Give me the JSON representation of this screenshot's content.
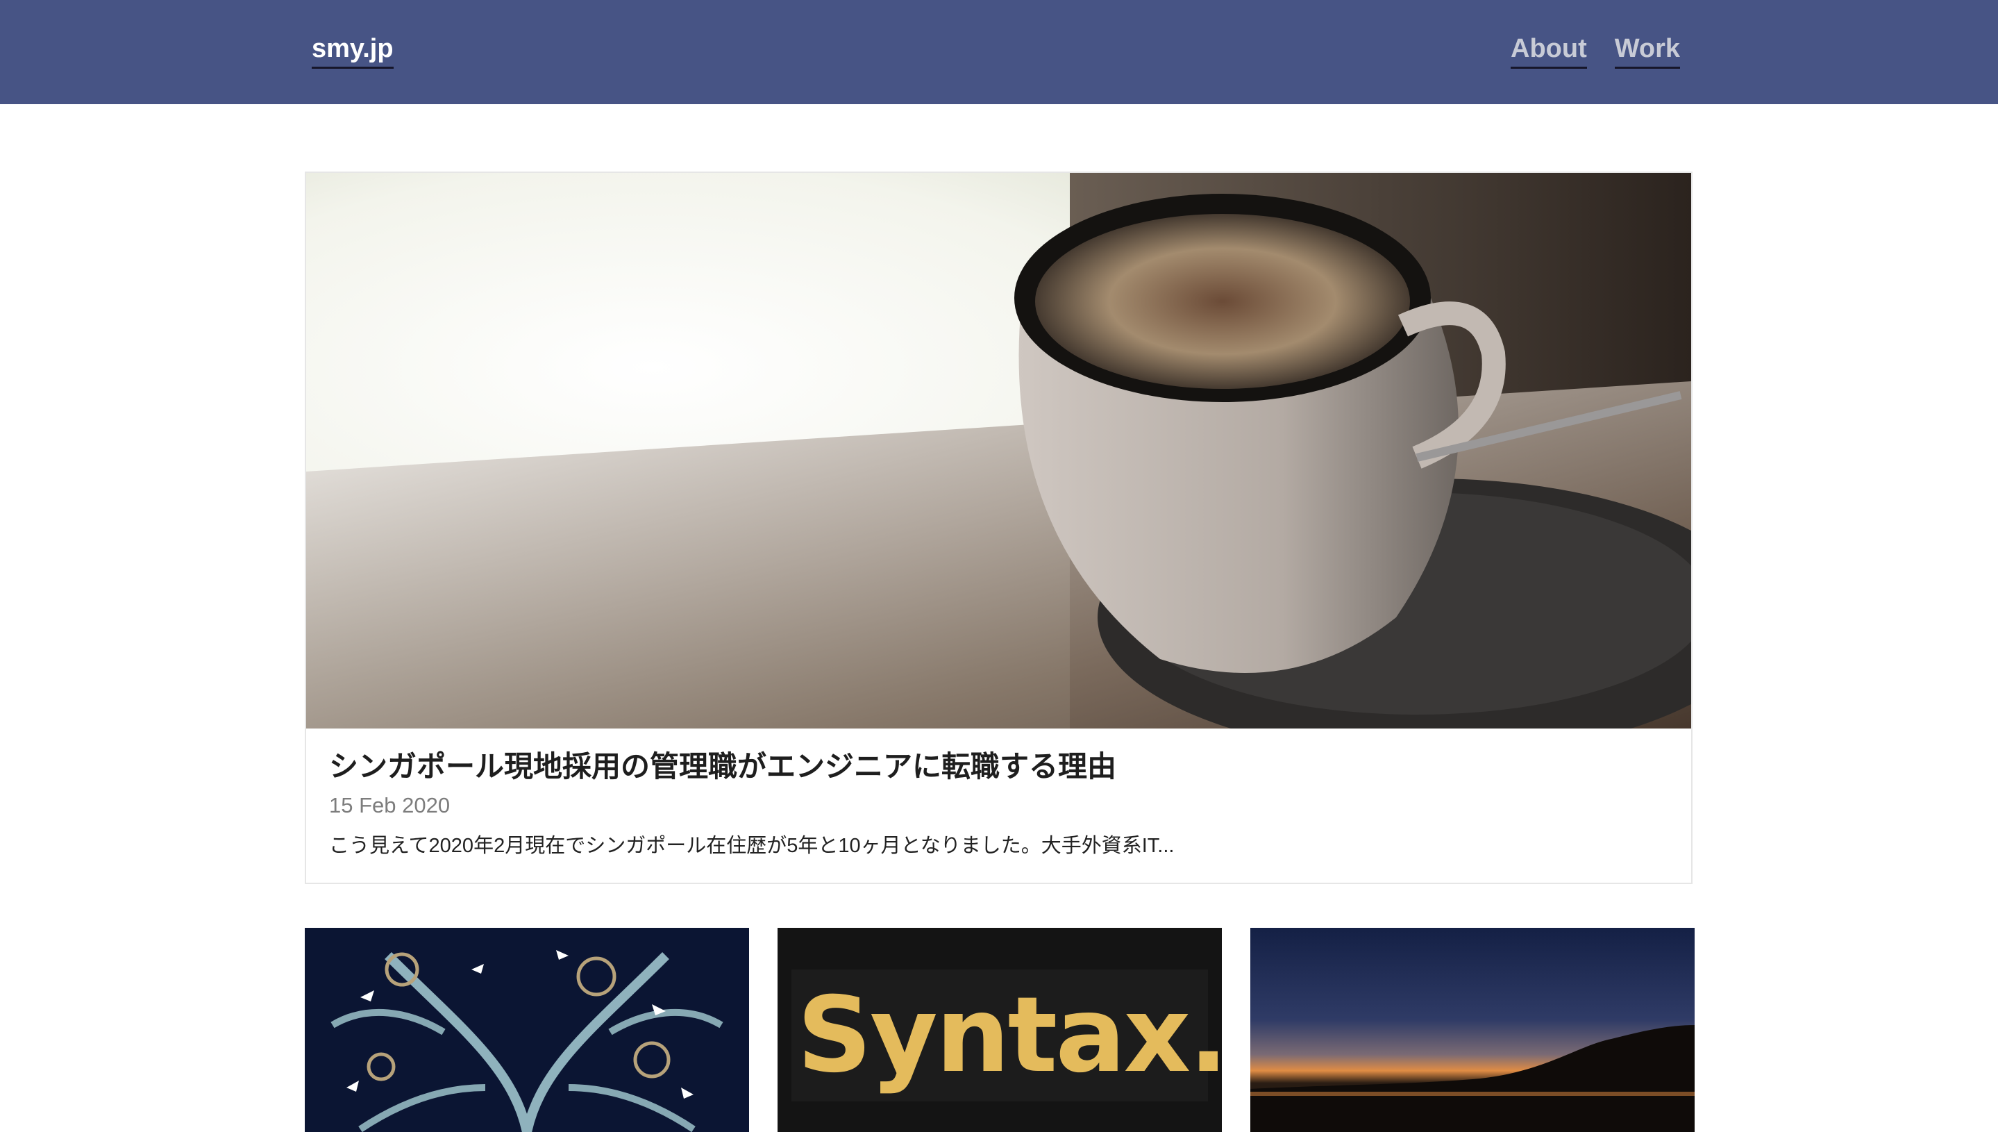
{
  "site": {
    "brand": "smy.jp",
    "nav": [
      {
        "label": "About"
      },
      {
        "label": "Work"
      }
    ],
    "colors": {
      "header_bg": "#475485",
      "header_text": "#ffffff",
      "nav_text": "#c8cbd6"
    }
  },
  "featured": {
    "image_icon": "coffee-cup-photo",
    "title": "シンガポール現地採用の管理職がエンジニアに転職する理由",
    "date": "15 Feb 2020",
    "excerpt": "こう見えて2020年2月現在でシンガポール在住歴が5年と10ヶ月となりました。大手外資系IT..."
  },
  "cards": [
    {
      "image_icon": "botanical-illustration-photo"
    },
    {
      "image_icon": "syntax-logo-photo",
      "image_text": "Syntax."
    },
    {
      "image_icon": "sunset-lake-photo"
    }
  ]
}
